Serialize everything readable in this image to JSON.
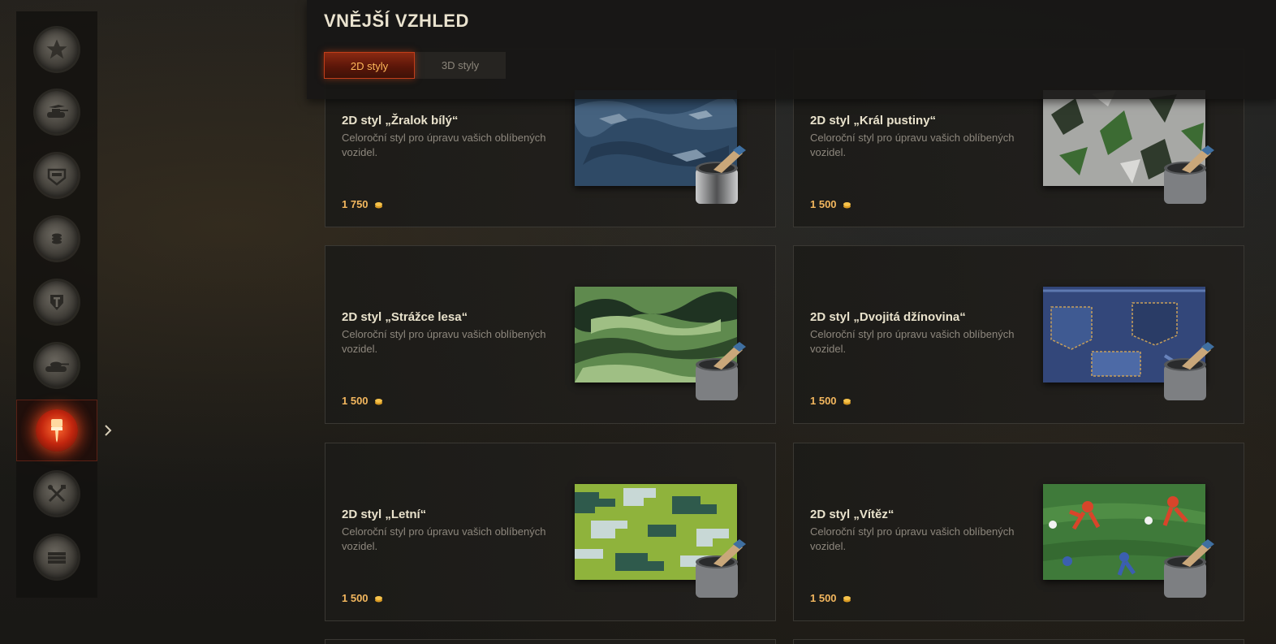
{
  "page": {
    "title": "VNĚJŠÍ VZHLED"
  },
  "tabs": [
    {
      "label": "2D styly",
      "active": true
    },
    {
      "label": "3D styly",
      "active": false
    }
  ],
  "sidebar": {
    "items": [
      {
        "icon": "star-icon"
      },
      {
        "icon": "tank-plane-icon"
      },
      {
        "icon": "tank-emblem-icon"
      },
      {
        "icon": "coins-wreath-icon"
      },
      {
        "icon": "wot-shield-wreath-icon"
      },
      {
        "icon": "tank-icon"
      },
      {
        "icon": "paintbrush-icon",
        "active": true
      },
      {
        "icon": "tools-icon"
      },
      {
        "icon": "money-stack-icon"
      }
    ]
  },
  "currency_icon": "gold-coin-icon",
  "items": [
    {
      "title": "2D styl „Žralok bílý“",
      "description": "Celoroční styl pro úpravu vašich oblíbených vozidel.",
      "price": "1 750",
      "swatch": "shark-camo"
    },
    {
      "title": "2D styl „Král pustiny“",
      "description": "Celoroční styl pro úpravu vašich oblíbených vozidel.",
      "price": "1 500",
      "swatch": "splinter-camo"
    },
    {
      "title": "2D styl „Strážce lesa“",
      "description": "Celoroční styl pro úpravu vašich oblíbených vozidel.",
      "price": "1 500",
      "swatch": "forest-camo"
    },
    {
      "title": "2D styl „Dvojitá džínovina“",
      "description": "Celoroční styl pro úpravu vašich oblíbených vozidel.",
      "price": "1 500",
      "swatch": "denim-camo"
    },
    {
      "title": "2D styl „Letní“",
      "description": "Celoroční styl pro úpravu vašich oblíbených vozidel.",
      "price": "1 500",
      "swatch": "summer-digital-camo"
    },
    {
      "title": "2D styl „Vítěz“",
      "description": "Celoroční styl pro úpravu vašich oblíbených vozidel.",
      "price": "1 500",
      "swatch": "football-camo"
    }
  ]
}
